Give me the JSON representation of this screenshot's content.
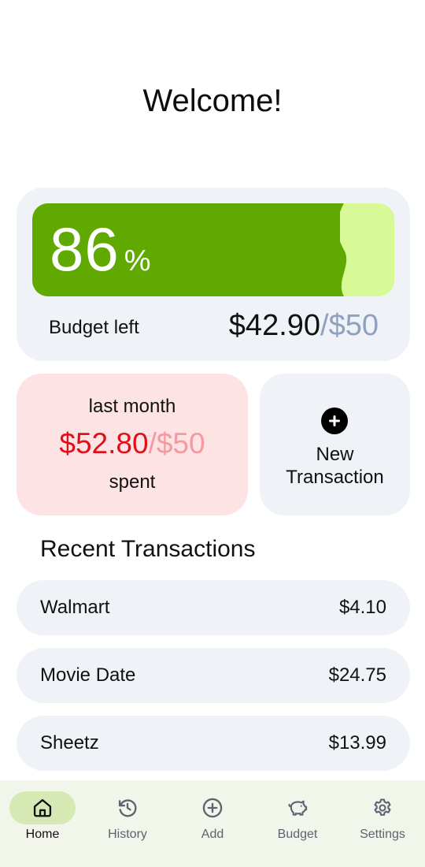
{
  "header": {
    "title": "Welcome!"
  },
  "budget": {
    "percent_value": "86",
    "percent_sign": "%",
    "fraction_left": 0.86,
    "label": "Budget left",
    "amount_left": "$42.90",
    "amount_limit": "/$50",
    "colors": {
      "fill": "#5fa900",
      "track": "#d7f996"
    }
  },
  "last_month": {
    "title": "last month",
    "spent": "$52.80",
    "limit": "/$50",
    "sub": "spent"
  },
  "new_transaction": {
    "icon": "plus-circle-icon",
    "line1": "New",
    "line2": "Transaction"
  },
  "recent": {
    "title": "Recent Transactions",
    "items": [
      {
        "name": "Walmart",
        "amount": "$4.10"
      },
      {
        "name": "Movie Date",
        "amount": "$24.75"
      },
      {
        "name": "Sheetz",
        "amount": "$13.99"
      }
    ]
  },
  "nav": {
    "items": [
      {
        "label": "Home",
        "icon": "home-icon",
        "active": true
      },
      {
        "label": "History",
        "icon": "history-icon"
      },
      {
        "label": "Add",
        "icon": "add-circle-icon"
      },
      {
        "label": "Budget",
        "icon": "piggy-bank-icon"
      },
      {
        "label": "Settings",
        "icon": "gear-icon"
      }
    ]
  }
}
